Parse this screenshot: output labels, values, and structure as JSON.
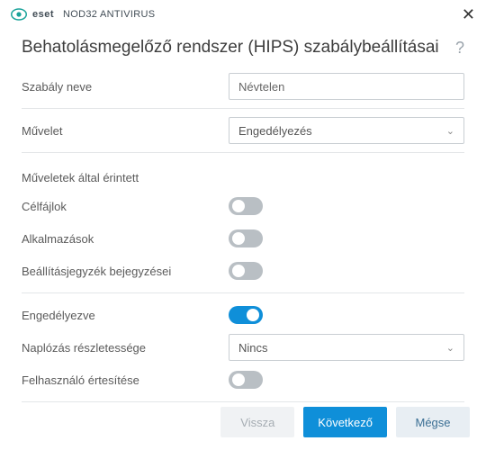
{
  "titlebar": {
    "brand": "eset",
    "product": "NOD32 ANTIVIRUS"
  },
  "header": {
    "title": "Behatolásmegelőző rendszer (HIPS) szabálybeállításai"
  },
  "fields": {
    "rule_name": {
      "label": "Szabály neve",
      "value": "Névtelen"
    },
    "action": {
      "label": "Művelet",
      "value": "Engedélyezés"
    },
    "affected_title": "Műveletek által érintett",
    "target_files": {
      "label": "Célfájlok",
      "on": false
    },
    "applications": {
      "label": "Alkalmazások",
      "on": false
    },
    "registry": {
      "label": "Beállításjegyzék bejegyzései",
      "on": false
    },
    "enabled": {
      "label": "Engedélyezve",
      "on": true
    },
    "log_level": {
      "label": "Naplózás részletessége",
      "value": "Nincs"
    },
    "notify": {
      "label": "Felhasználó értesítése",
      "on": false
    }
  },
  "footer": {
    "back": "Vissza",
    "next": "Következő",
    "cancel": "Mégse"
  }
}
